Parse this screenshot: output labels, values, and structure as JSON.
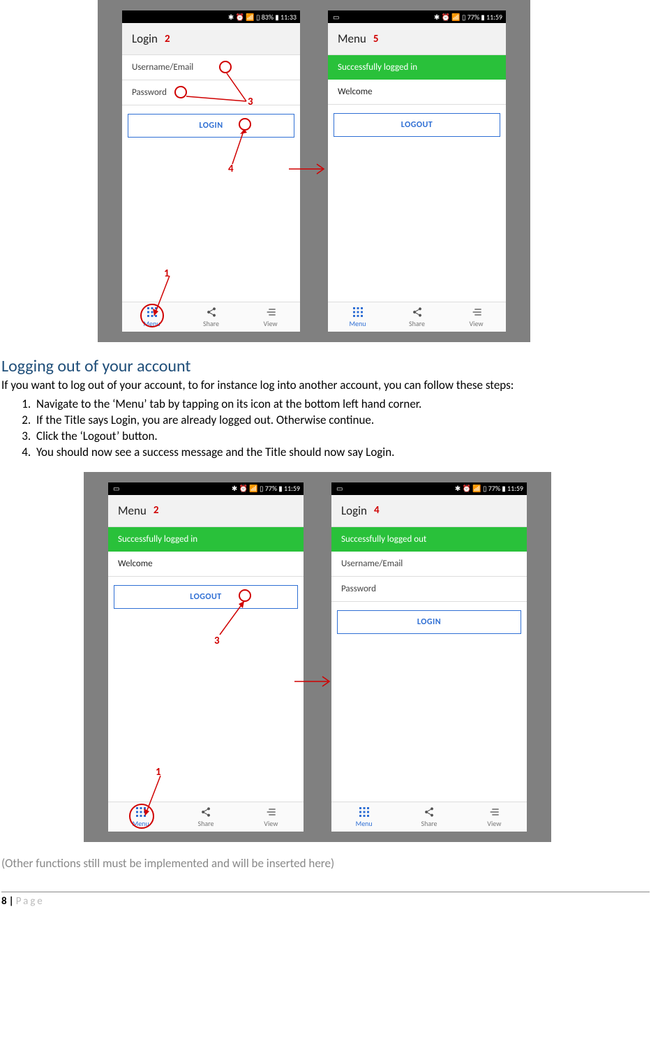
{
  "status": {
    "s1": "✱ ⏰ 📶 83% ▮ 11:33",
    "s2": "✱ ⏰ 📶 77% ▮ 11:59"
  },
  "titles": {
    "login": "Login",
    "menu": "Menu"
  },
  "annotations": {
    "a1": "1",
    "a2": "2",
    "a3": "3",
    "a4": "4",
    "a5": "5"
  },
  "banners": {
    "logged_in": "Successfully logged in",
    "logged_out": "Successfully logged out"
  },
  "fields": {
    "username": "Username/Email",
    "password": "Password",
    "welcome": "Welcome"
  },
  "buttons": {
    "login": "LOGIN",
    "logout": "LOGOUT"
  },
  "tabs": {
    "menu": "Menu",
    "share": "Share",
    "view": "View"
  },
  "doc": {
    "heading": "Logging out of your account",
    "intro": "If you want to log out of your account, to for instance log into another account, you can follow these steps:",
    "step1": "Navigate to the ‘Menu’ tab by tapping on its icon at the bottom left hand corner.",
    "step2": "If the Title says Login, you are already logged out. Otherwise continue.",
    "step3": "Click the ‘Logout’ button.",
    "step4": "You should now see a success message and the Title should now say Login.",
    "note": "(Other functions still must be implemented and will be inserted here)",
    "page_num": "8",
    "page_sep": "|",
    "page_word": "Page"
  }
}
